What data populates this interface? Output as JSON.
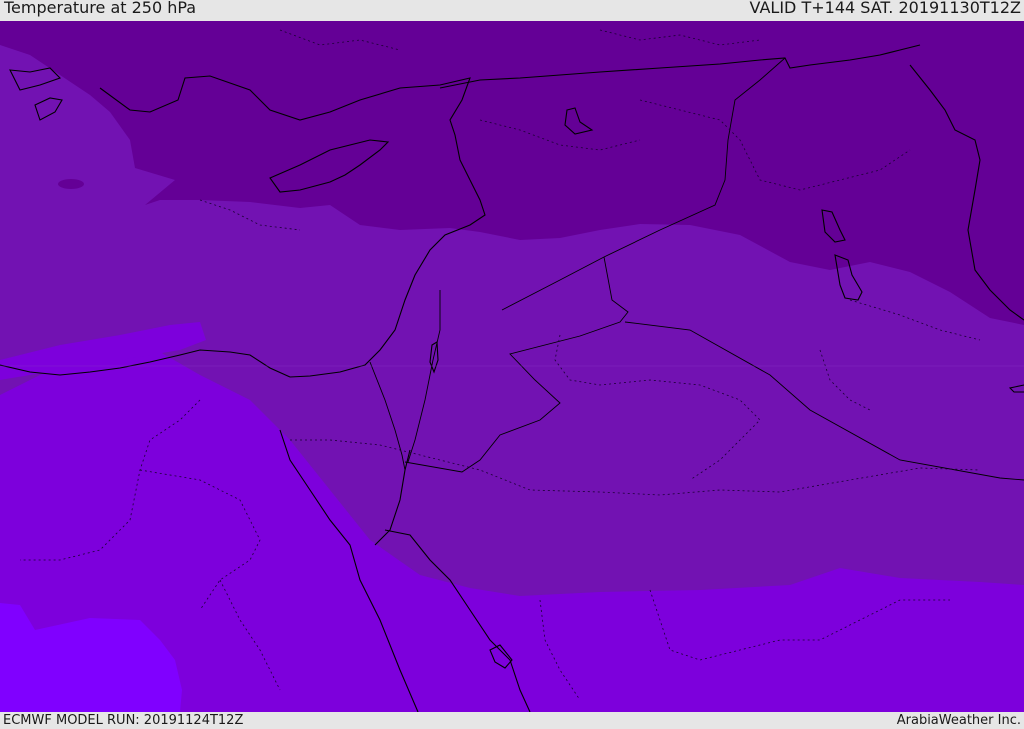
{
  "header": {
    "title": "Temperature at 250 hPa",
    "valid": "VALID T+144 SAT. 20191130T12Z"
  },
  "footer": {
    "model_run": "ECMWF MODEL RUN: 20191124T12Z",
    "credit": "ArabiaWeather Inc."
  },
  "map": {
    "field": "Temperature at 250 hPa",
    "colors": {
      "coldest": "#640096",
      "cold": "#7212b2",
      "mid": "#7d00dc",
      "warm": "#8000ff",
      "coastline": "#000000"
    }
  }
}
